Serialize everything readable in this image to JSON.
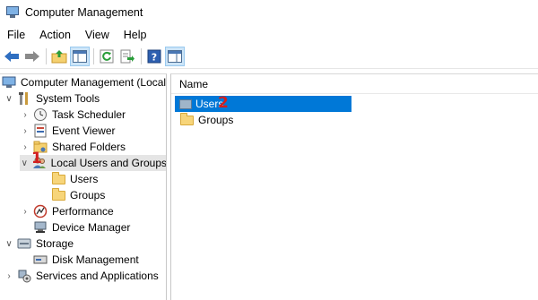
{
  "window": {
    "title": "Computer Management"
  },
  "menu": [
    "File",
    "Action",
    "View",
    "Help"
  ],
  "tree": [
    {
      "label": "Computer Management (Local",
      "expander": "",
      "icon": "computer-icon"
    },
    {
      "label": "System Tools",
      "expander": "∨",
      "icon": "tools-icon"
    },
    {
      "label": "Task Scheduler",
      "expander": "›",
      "icon": "clock-icon"
    },
    {
      "label": "Event Viewer",
      "expander": "›",
      "icon": "event-viewer-icon"
    },
    {
      "label": "Shared Folders",
      "expander": "›",
      "icon": "shared-folder-icon"
    },
    {
      "label": "Local Users and Groups",
      "expander": "∨",
      "icon": "users-groups-icon"
    },
    {
      "label": "Users",
      "expander": "",
      "icon": "folder-icon"
    },
    {
      "label": "Groups",
      "expander": "",
      "icon": "folder-icon"
    },
    {
      "label": "Performance",
      "expander": "›",
      "icon": "performance-icon"
    },
    {
      "label": "Device Manager",
      "expander": "",
      "icon": "device-manager-icon"
    },
    {
      "label": "Storage",
      "expander": "∨",
      "icon": "storage-icon"
    },
    {
      "label": "Disk Management",
      "expander": "",
      "icon": "disk-icon"
    },
    {
      "label": "Services and Applications",
      "expander": "›",
      "icon": "services-icon"
    }
  ],
  "list": {
    "column_header": "Name",
    "items": [
      "Users",
      "Groups"
    ]
  },
  "annotations": {
    "step1": "1",
    "step2": "2"
  }
}
